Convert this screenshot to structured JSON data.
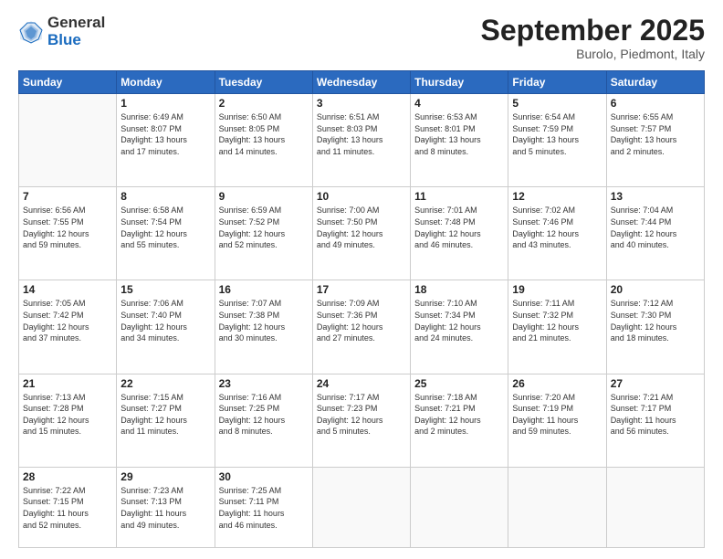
{
  "logo": {
    "general": "General",
    "blue": "Blue"
  },
  "title": "September 2025",
  "subtitle": "Burolo, Piedmont, Italy",
  "days_of_week": [
    "Sunday",
    "Monday",
    "Tuesday",
    "Wednesday",
    "Thursday",
    "Friday",
    "Saturday"
  ],
  "weeks": [
    [
      {
        "day": "",
        "info": ""
      },
      {
        "day": "1",
        "info": "Sunrise: 6:49 AM\nSunset: 8:07 PM\nDaylight: 13 hours\nand 17 minutes."
      },
      {
        "day": "2",
        "info": "Sunrise: 6:50 AM\nSunset: 8:05 PM\nDaylight: 13 hours\nand 14 minutes."
      },
      {
        "day": "3",
        "info": "Sunrise: 6:51 AM\nSunset: 8:03 PM\nDaylight: 13 hours\nand 11 minutes."
      },
      {
        "day": "4",
        "info": "Sunrise: 6:53 AM\nSunset: 8:01 PM\nDaylight: 13 hours\nand 8 minutes."
      },
      {
        "day": "5",
        "info": "Sunrise: 6:54 AM\nSunset: 7:59 PM\nDaylight: 13 hours\nand 5 minutes."
      },
      {
        "day": "6",
        "info": "Sunrise: 6:55 AM\nSunset: 7:57 PM\nDaylight: 13 hours\nand 2 minutes."
      }
    ],
    [
      {
        "day": "7",
        "info": "Sunrise: 6:56 AM\nSunset: 7:55 PM\nDaylight: 12 hours\nand 59 minutes."
      },
      {
        "day": "8",
        "info": "Sunrise: 6:58 AM\nSunset: 7:54 PM\nDaylight: 12 hours\nand 55 minutes."
      },
      {
        "day": "9",
        "info": "Sunrise: 6:59 AM\nSunset: 7:52 PM\nDaylight: 12 hours\nand 52 minutes."
      },
      {
        "day": "10",
        "info": "Sunrise: 7:00 AM\nSunset: 7:50 PM\nDaylight: 12 hours\nand 49 minutes."
      },
      {
        "day": "11",
        "info": "Sunrise: 7:01 AM\nSunset: 7:48 PM\nDaylight: 12 hours\nand 46 minutes."
      },
      {
        "day": "12",
        "info": "Sunrise: 7:02 AM\nSunset: 7:46 PM\nDaylight: 12 hours\nand 43 minutes."
      },
      {
        "day": "13",
        "info": "Sunrise: 7:04 AM\nSunset: 7:44 PM\nDaylight: 12 hours\nand 40 minutes."
      }
    ],
    [
      {
        "day": "14",
        "info": "Sunrise: 7:05 AM\nSunset: 7:42 PM\nDaylight: 12 hours\nand 37 minutes."
      },
      {
        "day": "15",
        "info": "Sunrise: 7:06 AM\nSunset: 7:40 PM\nDaylight: 12 hours\nand 34 minutes."
      },
      {
        "day": "16",
        "info": "Sunrise: 7:07 AM\nSunset: 7:38 PM\nDaylight: 12 hours\nand 30 minutes."
      },
      {
        "day": "17",
        "info": "Sunrise: 7:09 AM\nSunset: 7:36 PM\nDaylight: 12 hours\nand 27 minutes."
      },
      {
        "day": "18",
        "info": "Sunrise: 7:10 AM\nSunset: 7:34 PM\nDaylight: 12 hours\nand 24 minutes."
      },
      {
        "day": "19",
        "info": "Sunrise: 7:11 AM\nSunset: 7:32 PM\nDaylight: 12 hours\nand 21 minutes."
      },
      {
        "day": "20",
        "info": "Sunrise: 7:12 AM\nSunset: 7:30 PM\nDaylight: 12 hours\nand 18 minutes."
      }
    ],
    [
      {
        "day": "21",
        "info": "Sunrise: 7:13 AM\nSunset: 7:28 PM\nDaylight: 12 hours\nand 15 minutes."
      },
      {
        "day": "22",
        "info": "Sunrise: 7:15 AM\nSunset: 7:27 PM\nDaylight: 12 hours\nand 11 minutes."
      },
      {
        "day": "23",
        "info": "Sunrise: 7:16 AM\nSunset: 7:25 PM\nDaylight: 12 hours\nand 8 minutes."
      },
      {
        "day": "24",
        "info": "Sunrise: 7:17 AM\nSunset: 7:23 PM\nDaylight: 12 hours\nand 5 minutes."
      },
      {
        "day": "25",
        "info": "Sunrise: 7:18 AM\nSunset: 7:21 PM\nDaylight: 12 hours\nand 2 minutes."
      },
      {
        "day": "26",
        "info": "Sunrise: 7:20 AM\nSunset: 7:19 PM\nDaylight: 11 hours\nand 59 minutes."
      },
      {
        "day": "27",
        "info": "Sunrise: 7:21 AM\nSunset: 7:17 PM\nDaylight: 11 hours\nand 56 minutes."
      }
    ],
    [
      {
        "day": "28",
        "info": "Sunrise: 7:22 AM\nSunset: 7:15 PM\nDaylight: 11 hours\nand 52 minutes."
      },
      {
        "day": "29",
        "info": "Sunrise: 7:23 AM\nSunset: 7:13 PM\nDaylight: 11 hours\nand 49 minutes."
      },
      {
        "day": "30",
        "info": "Sunrise: 7:25 AM\nSunset: 7:11 PM\nDaylight: 11 hours\nand 46 minutes."
      },
      {
        "day": "",
        "info": ""
      },
      {
        "day": "",
        "info": ""
      },
      {
        "day": "",
        "info": ""
      },
      {
        "day": "",
        "info": ""
      }
    ]
  ]
}
